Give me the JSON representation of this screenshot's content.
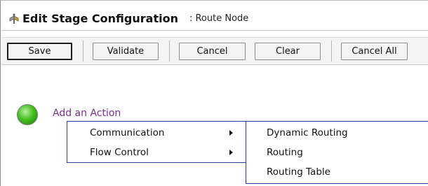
{
  "header": {
    "title": "Edit Stage Configuration",
    "subtitle": ": Route Node",
    "icon": "route-node-icon"
  },
  "toolbar": {
    "save_label": "Save",
    "validate_label": "Validate",
    "cancel_label": "Cancel",
    "clear_label": "Clear",
    "cancel_all_label": "Cancel All"
  },
  "content": {
    "add_action_label": "Add an Action",
    "status_color": "#46c020"
  },
  "menu": {
    "items": [
      {
        "label": "Communication"
      },
      {
        "label": "Flow Control"
      }
    ],
    "submenu": [
      {
        "label": "Dynamic Routing"
      },
      {
        "label": "Routing"
      },
      {
        "label": "Routing Table"
      }
    ]
  },
  "colors": {
    "link": "#7b2d8d",
    "menu_border": "#2c3ea0"
  }
}
